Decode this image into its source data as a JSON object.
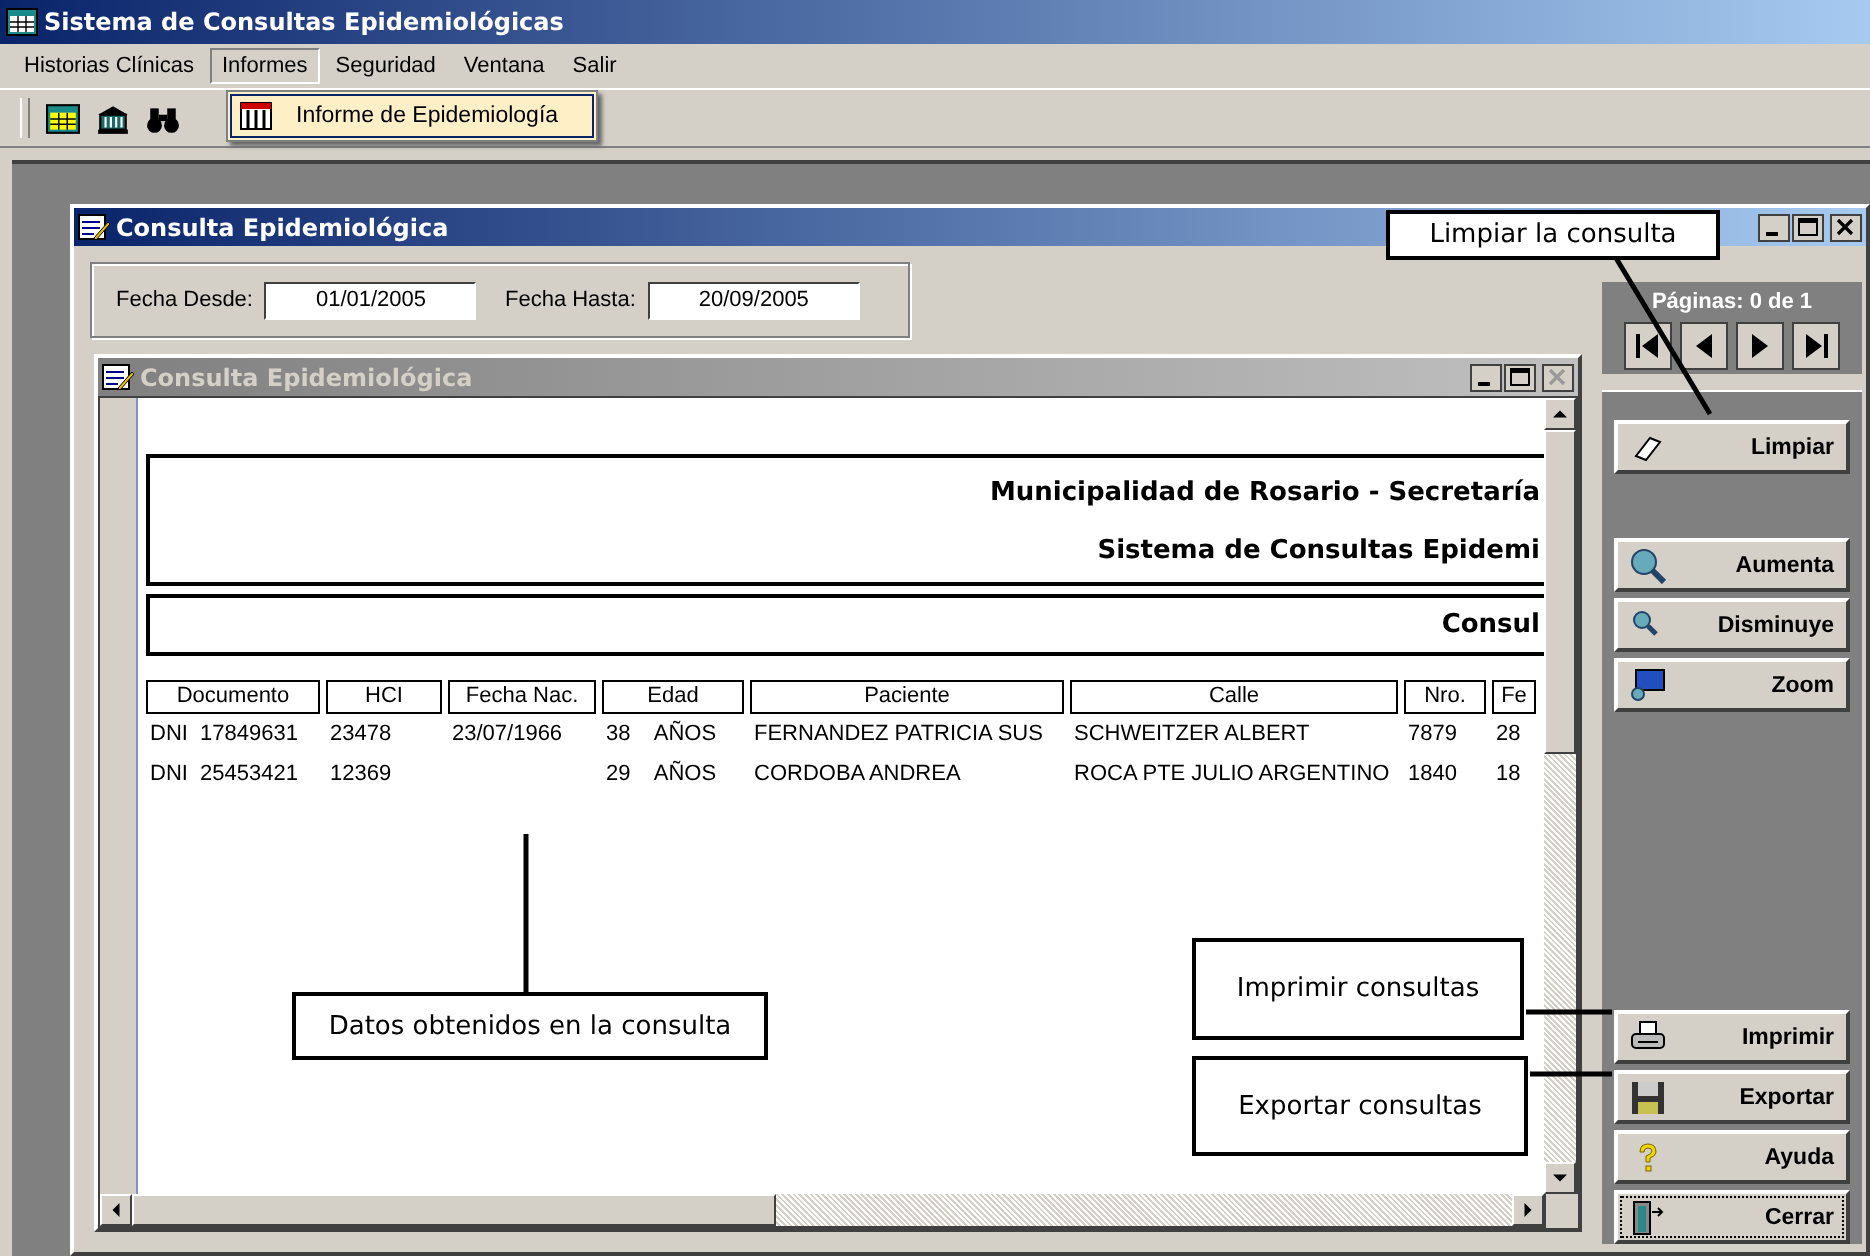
{
  "app_window": {
    "title": "Sistema de Consultas Epidemiológicas"
  },
  "menu_bar": [
    {
      "label": "Historias Clínicas",
      "selected": false
    },
    {
      "label": "Informes",
      "selected": true
    },
    {
      "label": "Seguridad",
      "selected": false
    },
    {
      "label": "Ventana",
      "selected": false
    },
    {
      "label": "Salir",
      "selected": false
    }
  ],
  "dropdown": [
    {
      "label": "Informe de Epidemiología",
      "selected": true
    }
  ],
  "consulta_window": {
    "title": "Consulta Epidemiológica",
    "fecha_desde": {
      "label": "Fecha Desde:",
      "value": "01/01/2005"
    },
    "fecha_hasta": {
      "label": "Fecha Hasta:",
      "value": "20/09/2005"
    }
  },
  "report_window": {
    "title": "Consulta Epidemiológica",
    "active": false,
    "header_lines": [
      "Municipalidad de Rosario - Secretaría",
      "Sistema de Consultas Epidemi"
    ],
    "subtitle": "Consul",
    "table": {
      "columns": [
        "Documento",
        "HCI",
        "Fecha Nac.",
        "Edad",
        "Paciente",
        "Calle",
        "Nro.",
        "Fe"
      ],
      "rows": [
        [
          "DNI  17849631",
          "23478",
          "23/07/1966",
          "38    AÑOS",
          "FERNANDEZ PATRICIA SUS",
          "SCHWEITZER ALBERT",
          "7879",
          "28"
        ],
        [
          "DNI  25453421",
          "12369",
          "",
          "29    AÑOS",
          "CORDOBA ANDREA",
          "ROCA PTE JULIO ARGENTINO",
          "1840",
          "18"
        ]
      ]
    }
  },
  "pager": {
    "label": "Páginas: 0 de 1"
  },
  "side_buttons": [
    {
      "label": "Limpiar",
      "kind": "eraser",
      "focused": false
    },
    {
      "label": "Aumenta",
      "kind": "zoomin",
      "focused": false
    },
    {
      "label": "Disminuye",
      "kind": "zoomout",
      "focused": false
    },
    {
      "label": "Zoom",
      "kind": "monitor",
      "focused": false
    },
    {
      "label": "Imprimir",
      "kind": "printer",
      "focused": false
    },
    {
      "label": "Exportar",
      "kind": "floppy",
      "focused": false
    },
    {
      "label": "Ayuda",
      "kind": "help",
      "focused": false
    },
    {
      "label": "Cerrar",
      "kind": "exit",
      "focused": true
    }
  ],
  "callouts": [
    "Limpiar la consulta",
    "Imprimir consultas",
    "Exportar consultas",
    "Datos obtenidos en la consulta"
  ]
}
